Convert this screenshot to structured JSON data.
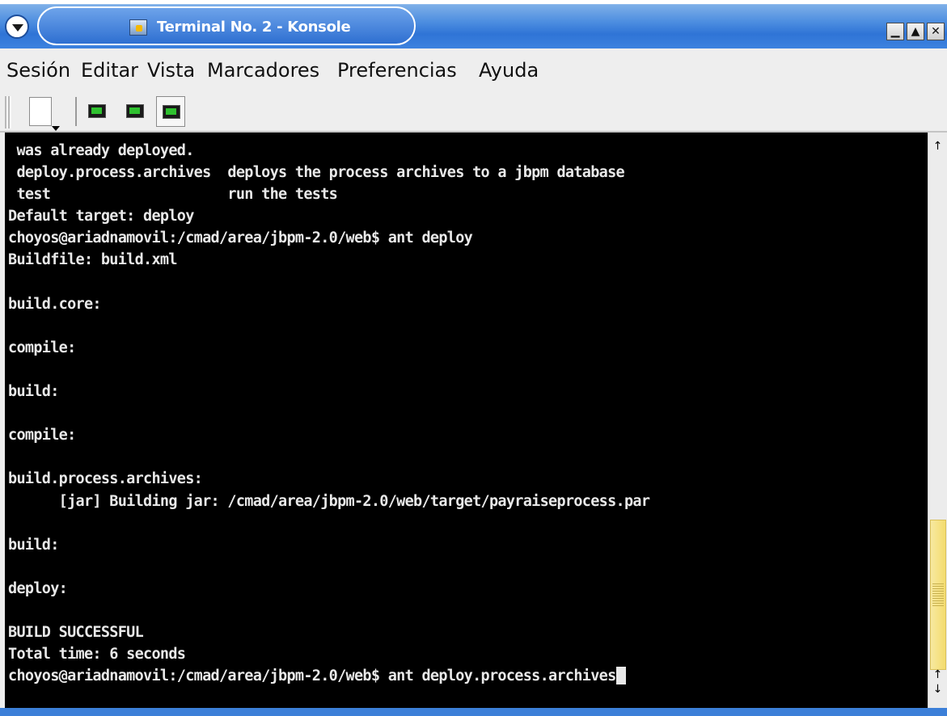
{
  "window": {
    "title": "Terminal No. 2 - Konsole",
    "app_icon": "konsole-icon",
    "controls": {
      "minimize": "▁",
      "maximize": "▲",
      "close": "✕"
    }
  },
  "menubar": {
    "items": [
      "Sesión",
      "Editar",
      "Vista",
      "Marcadores",
      "Preferencias",
      "Ayuda"
    ]
  },
  "toolbar": {
    "icons": [
      "new-session-icon",
      "terminal-session-icon",
      "terminal-session-icon",
      "terminal-session-icon"
    ]
  },
  "terminal": {
    "lines": [
      " was already deployed.",
      " deploy.process.archives  deploys the process archives to a jbpm database",
      " test                     run the tests",
      "Default target: deploy",
      "choyos@ariadnamovil:/cmad/area/jbpm-2.0/web$ ant deploy",
      "Buildfile: build.xml",
      "",
      "build.core:",
      "",
      "compile:",
      "",
      "build:",
      "",
      "compile:",
      "",
      "build.process.archives:",
      "      [jar] Building jar: /cmad/area/jbpm-2.0/web/target/payraiseprocess.par",
      "",
      "build:",
      "",
      "deploy:",
      "",
      "BUILD SUCCESSFUL",
      "Total time: 6 seconds"
    ],
    "prompt_line": "choyos@ariadnamovil:/cmad/area/jbpm-2.0/web$ ant deploy.process.archives",
    "colors": {
      "background": "#000000",
      "foreground": "#e8e8e8"
    }
  },
  "scrollbar": {
    "up_arrow": "↑",
    "down_arrow": "↓",
    "position": 0.95
  },
  "theme": {
    "titlebar_color": "#2f74d6",
    "scroll_thumb_color": "#f4dc6e"
  }
}
